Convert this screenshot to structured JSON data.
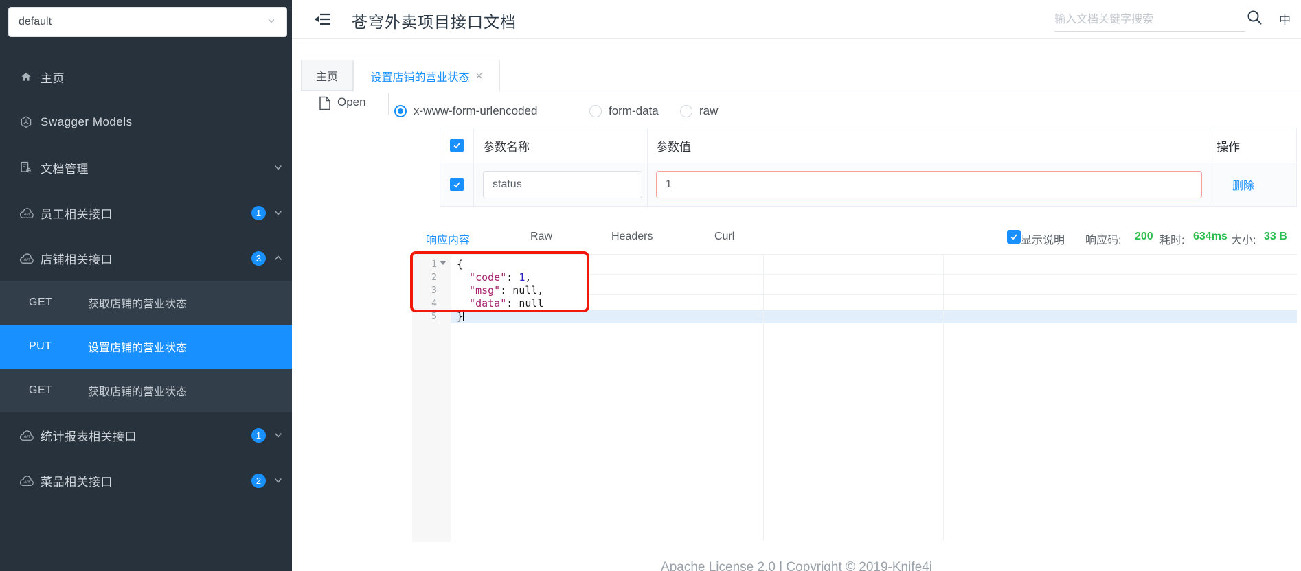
{
  "sidebar": {
    "group_select": "default",
    "items": [
      {
        "label": "主页",
        "icon": "home-icon"
      },
      {
        "label": "Swagger Models",
        "icon": "swagger-models-icon"
      },
      {
        "label": "文档管理",
        "icon": "doc-manage-icon",
        "chevron": "down"
      },
      {
        "label": "员工相关接口",
        "icon": "api-cloud-icon",
        "badge": "1",
        "chevron": "down"
      },
      {
        "label": "店铺相关接口",
        "icon": "api-cloud-icon",
        "badge": "3",
        "chevron": "up",
        "children": [
          {
            "method": "GET",
            "label": "获取店铺的营业状态"
          },
          {
            "method": "PUT",
            "label": "设置店铺的营业状态",
            "active": true
          },
          {
            "method": "GET",
            "label": "获取店铺的营业状态"
          }
        ]
      },
      {
        "label": "统计报表相关接口",
        "icon": "api-cloud-icon",
        "badge": "1",
        "chevron": "down"
      },
      {
        "label": "菜品相关接口",
        "icon": "api-cloud-icon",
        "badge": "2",
        "chevron": "down"
      }
    ]
  },
  "header": {
    "title": "苍穹外卖项目接口文档",
    "search_placeholder": "输入文档关键字搜索",
    "lang": "中"
  },
  "tabs": [
    {
      "label": "主页"
    },
    {
      "label": "设置店铺的营业状态",
      "active": true,
      "close": "×"
    }
  ],
  "debug": {
    "open_label": "Open",
    "body_types": [
      {
        "label": "x-www-form-urlencoded",
        "selected": true
      },
      {
        "label": "form-data"
      },
      {
        "label": "raw"
      }
    ],
    "param_table": {
      "headers": {
        "name": "参数名称",
        "value": "参数值",
        "action": "操作"
      },
      "row": {
        "name": "status",
        "value": "1",
        "action": "删除"
      }
    },
    "response_tabs": [
      {
        "label": "响应内容",
        "active": true
      },
      {
        "label": "Raw"
      },
      {
        "label": "Headers"
      },
      {
        "label": "Curl"
      }
    ],
    "response_meta": {
      "show_desc_label": "显示说明",
      "status_label": "响应码:",
      "status_value": "200",
      "time_label": "耗时:",
      "time_value": "634ms",
      "size_label": "大小:",
      "size_value": "33 B"
    },
    "editor": {
      "lines": [
        {
          "n": "1",
          "fold": true,
          "tokens": [
            {
              "t": "{",
              "c": "plain"
            }
          ]
        },
        {
          "n": "2",
          "tokens": [
            {
              "t": "  \"code\"",
              "c": "key"
            },
            {
              "t": ": ",
              "c": "plain"
            },
            {
              "t": "1",
              "c": "number"
            },
            {
              "t": ",",
              "c": "plain"
            }
          ]
        },
        {
          "n": "3",
          "tokens": [
            {
              "t": "  \"msg\"",
              "c": "key"
            },
            {
              "t": ": ",
              "c": "plain"
            },
            {
              "t": "null",
              "c": "plain"
            },
            {
              "t": ",",
              "c": "plain"
            }
          ]
        },
        {
          "n": "4",
          "tokens": [
            {
              "t": "  \"data\"",
              "c": "key"
            },
            {
              "t": ": ",
              "c": "plain"
            },
            {
              "t": "null",
              "c": "plain"
            }
          ]
        },
        {
          "n": "5",
          "active": true,
          "cursor": true,
          "tokens": [
            {
              "t": "}",
              "c": "plain"
            }
          ]
        }
      ]
    }
  },
  "footer": {
    "text": "Apache License 2.0 | Copyright © 2019-Knife4j"
  },
  "colors": {
    "accent": "#1890ff",
    "success_green": "#2cbe4e",
    "error_input_border": "#f3a39c",
    "annotation_red": "#f2190a",
    "code_key": "#a6216e",
    "code_number": "#2d24c3",
    "sidebar_bg": "#28323c",
    "submenu_bg": "#323e4a"
  }
}
